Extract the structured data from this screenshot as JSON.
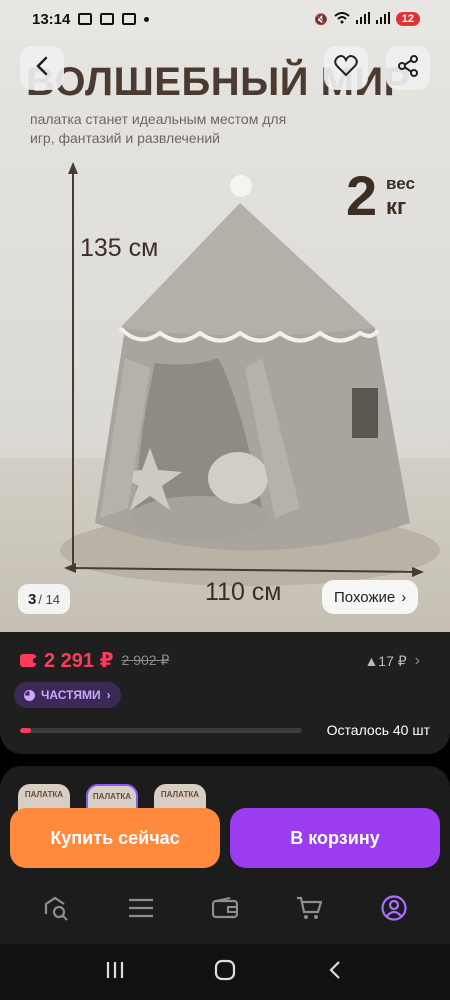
{
  "status_bar": {
    "time": "13:14",
    "signal_text": "",
    "battery": "12"
  },
  "hero": {
    "title": "ВОЛШЕБНЫЙ МИР",
    "subtitle": "палатка станет идеальным местом для игр, фантазий и развлечений",
    "weight_number": "2",
    "weight_label_top": "вес",
    "weight_label_bottom": "кг",
    "height_label": "135 см",
    "width_label": "110 см",
    "page_current": "3",
    "page_total": "/ 14",
    "similar_label": "Похожие",
    "similar_chevron": "›"
  },
  "price": {
    "current": "2 291 ₽",
    "old": "2 902 ₽",
    "bonus": "▲17 ₽",
    "installments_label": "ЧАСТЯМИ",
    "stock_fraction": 0.04,
    "remaining_label": "Осталось 40 шт"
  },
  "variants": [
    {
      "label": "ПАЛАТКА"
    },
    {
      "label": "ПАЛАТКА"
    },
    {
      "label": "ПАЛАТКА"
    }
  ],
  "actions": {
    "buy_now": "Купить сейчас",
    "add_to_cart": "В корзину"
  },
  "bottom_nav": [
    {
      "icon": "search-icon"
    },
    {
      "icon": "menu-icon"
    },
    {
      "icon": "wallet-icon"
    },
    {
      "icon": "cart-icon"
    },
    {
      "icon": "profile-icon"
    }
  ],
  "colors": {
    "accent_price": "#ff3b5c",
    "buy_now": "#ff8a3d",
    "add_to_cart": "#9b3cf0",
    "installments": "#c9a8ff",
    "active_nav": "#a970ff"
  }
}
